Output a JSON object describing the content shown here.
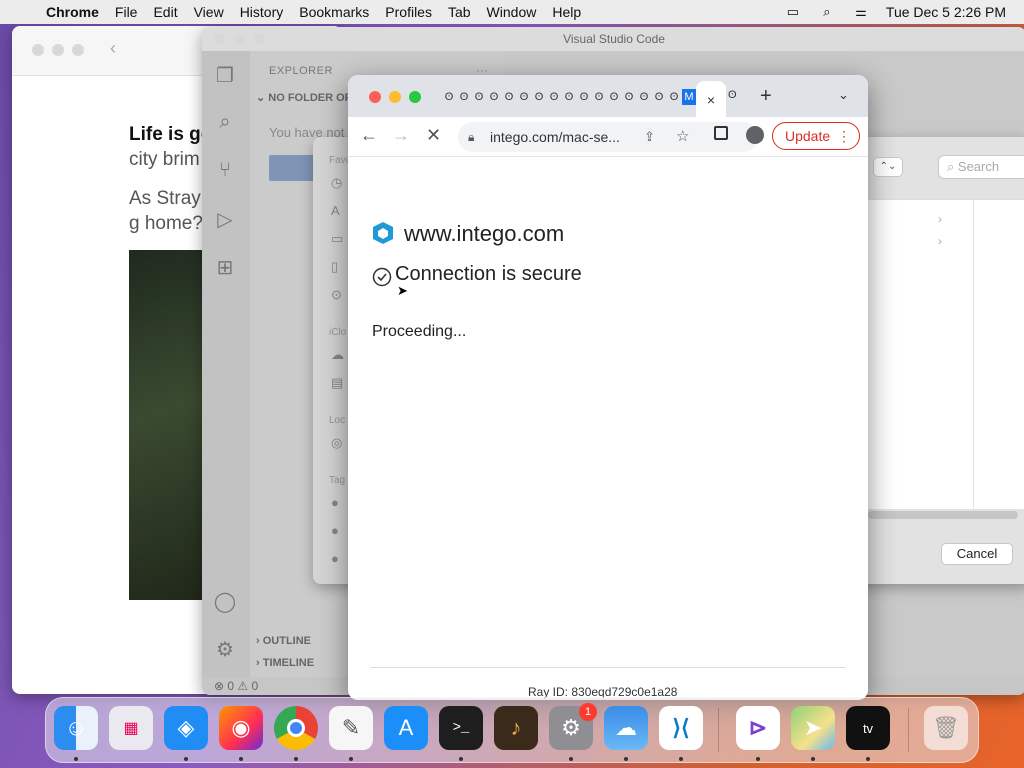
{
  "menubar": {
    "apple_icon": "apple-logo",
    "app_name": "Chrome",
    "items": [
      "File",
      "Edit",
      "View",
      "History",
      "Bookmarks",
      "Profiles",
      "Tab",
      "Window",
      "Help"
    ],
    "clock": "Tue Dec 5  2:26 PM"
  },
  "left_window": {
    "article_lines": [
      {
        "bold": "Life is go",
        "rest": "city brim"
      },
      "As Stray robots w people g home? A find out."
    ]
  },
  "vscode": {
    "title": "Visual Studio Code",
    "explorer_label": "EXPLORER",
    "no_folder_label": "NO FOLDER OP",
    "you_have_not": "You have not",
    "outline_label": "OUTLINE",
    "timeline_label": "TIMELINE",
    "status": "⊗ 0 ⚠ 0",
    "settings_badge": "1"
  },
  "finder_dialog": {
    "section_labels": [
      "Favo",
      "iClo",
      "Loc",
      "Tag"
    ],
    "search_placeholder": "Search",
    "cancel_label": "Cancel"
  },
  "chrome": {
    "tab_glyph": "ʘ",
    "active_tab_glyph": "M",
    "close_tab_icon": "×",
    "new_tab_icon": "+",
    "url": "intego.com/mac-se...",
    "update_label": "Update",
    "page": {
      "site": "www.intego.com",
      "status": "Connection is secure",
      "proceeding": "Proceeding...",
      "ray_id": "Ray ID: 830eqd729c0e1a28"
    }
  },
  "dock": {
    "apps": [
      "Finder",
      "Launchpad",
      "Safari",
      "Firefox",
      "Chrome",
      "TextEdit",
      "App Store",
      "Terminal",
      "GarageBand",
      "System Settings",
      "Weather",
      "Visual Studio Code",
      "Visual Studio",
      "Maps",
      "Apple TV",
      "Trash"
    ],
    "settings_badge": "1"
  },
  "colors": {
    "accent": "#1a73e8",
    "update_red": "#d93025",
    "intego_blue": "#1e9bd7"
  }
}
